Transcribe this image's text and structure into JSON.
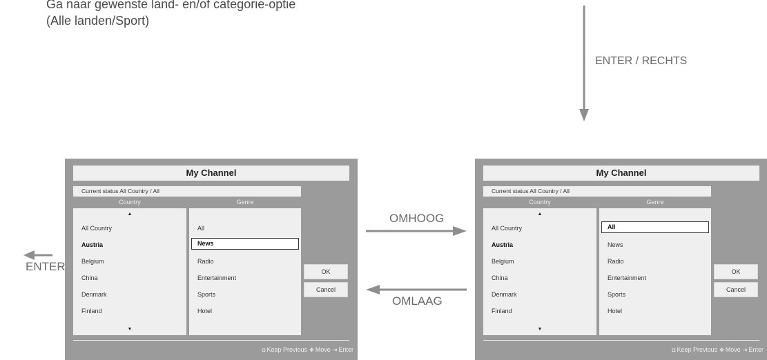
{
  "intro": {
    "line1": "Ga naar gewenste land- en/of categorie-optie",
    "line2": "(Alle landen/Sport)"
  },
  "labels": {
    "enter_right": "ENTER / RECHTS",
    "up": "OMHOOG",
    "down": "OMLAAG",
    "enter": "ENTER"
  },
  "colors": {
    "arrow": "#8e8e8e",
    "panel": "#9b9b9b",
    "panel_inner": "#efefef"
  },
  "left_panel": {
    "title": "My Channel",
    "status": "Current status All Country / All",
    "country_header": "Country",
    "genre_header": "Genre",
    "countries": [
      "All Country",
      "Austria",
      "Belgium",
      "China",
      "Denmark",
      "Finland"
    ],
    "genres": [
      "All",
      "News",
      "Radio",
      "Entertainment",
      "Sports",
      "Hotel"
    ],
    "bold_country": "Austria",
    "selected_genre": "News",
    "ok_label": "OK",
    "cancel_label": "Cancel",
    "footer": {
      "keep_previous": "Keep Previous",
      "move": "Move",
      "enter": "Enter"
    }
  },
  "right_panel": {
    "title": "My Channel",
    "status": "Current status All Country / All",
    "country_header": "Country",
    "genre_header": "Genre",
    "countries": [
      "All Country",
      "Austria",
      "Belgium",
      "China",
      "Denmark",
      "Finland"
    ],
    "genres": [
      "All",
      "News",
      "Radio",
      "Entertainment",
      "Sports",
      "Hotel"
    ],
    "bold_country": "Austria",
    "selected_genre": "All",
    "ok_label": "OK",
    "cancel_label": "Cancel",
    "footer": {
      "keep_previous": "Keep Previous",
      "move": "Move",
      "enter": "Enter"
    }
  },
  "icons": {
    "scroll_up": "▲",
    "scroll_down": "▼",
    "keep_previous": "◘",
    "move": "✥",
    "enter": "⇥"
  }
}
